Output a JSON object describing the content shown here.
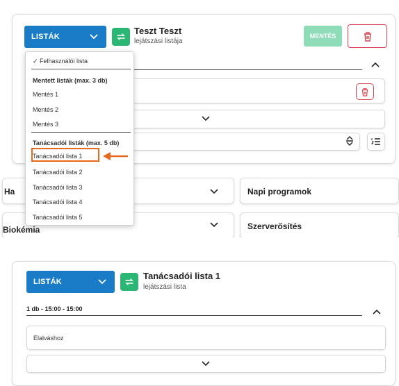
{
  "panel_top": {
    "lists_button_label": "LISTÁK",
    "title": "Teszt Teszt",
    "subtitle": "lejátszási listája",
    "save_label": "MENTÉS",
    "colors": {
      "blue": "#1a7cc6",
      "green": "#2bb673",
      "save_disabled": "#8fdcb8",
      "delete_red": "#d9434d",
      "highlight": "#e8681e"
    }
  },
  "dropdown": {
    "checked_item": "Felhasználói lista",
    "saved_header": "Mentett listák (max. 3 db)",
    "saved_items": [
      "Mentés 1",
      "Mentés 2",
      "Mentés 3"
    ],
    "advisor_header": "Tanácsadói listák (max. 5 db)",
    "advisor_items": [
      "Tanácsadói lista 1",
      "Tanácsadói lista 2",
      "Tanácsadói lista 3",
      "Tanácsadói lista 4",
      "Tanácsadói lista 5"
    ],
    "highlighted_item": "Tanácsadói lista 1"
  },
  "sections": {
    "left_row1": "Ha",
    "right_row1": "Napi programok",
    "left_row2": "Biokémia",
    "right_row2": "Szerverősítés"
  },
  "panel_bottom": {
    "lists_button_label": "LISTÁK",
    "title": "Tanácsadói lista 1",
    "subtitle": "lejátszási lista",
    "time_label": "1 db - 15:00 - 15:00",
    "item_label": "Elalváshoz"
  }
}
